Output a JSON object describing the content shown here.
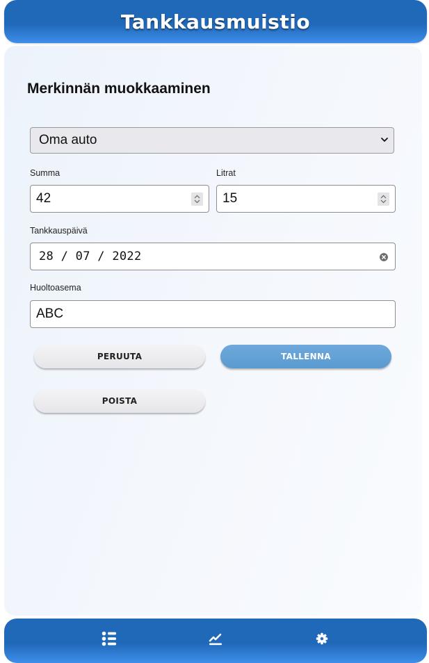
{
  "header": {
    "title": "Tankkausmuistio"
  },
  "page": {
    "title": "Merkinnän muokkaaminen"
  },
  "form": {
    "vehicle": {
      "selected": "Oma auto"
    },
    "amount": {
      "label": "Summa",
      "value": "42"
    },
    "liters": {
      "label": "Litrat",
      "value": "15"
    },
    "date": {
      "label": "Tankkauspäivä",
      "value": "28 / 07 / 2022"
    },
    "station": {
      "label": "Huoltoasema",
      "value": "ABC"
    }
  },
  "buttons": {
    "cancel": "PERUUTA",
    "save": "TALLENNA",
    "delete": "POISTA"
  },
  "nav": {
    "icons": [
      "list-icon",
      "chart-line-icon",
      "gear-icon"
    ]
  },
  "colors": {
    "header_bg": "#2068b8",
    "primary_button": "#5f9fd4",
    "panel_bg": "#eef3fb"
  }
}
